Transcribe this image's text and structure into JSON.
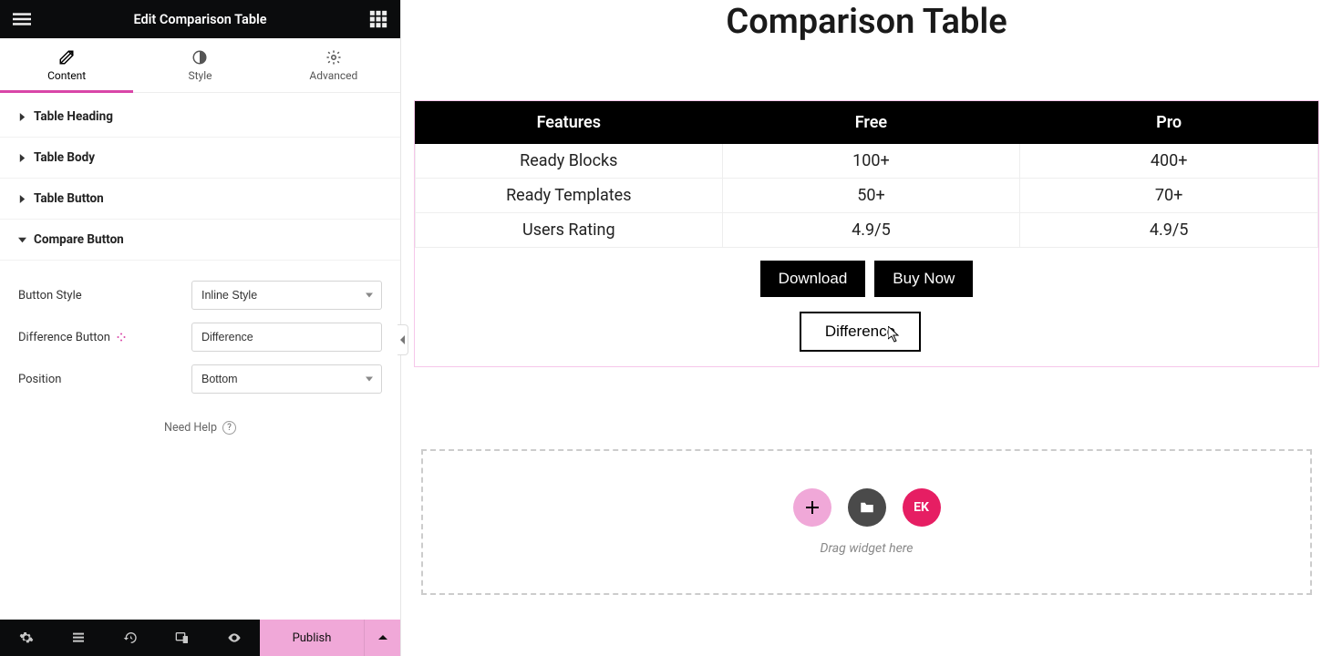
{
  "panel": {
    "title": "Edit Comparison Table",
    "tabs": {
      "content": "Content",
      "style": "Style",
      "advanced": "Advanced"
    },
    "sections": {
      "heading": "Table Heading",
      "body": "Table Body",
      "button": "Table Button",
      "compare": "Compare Button"
    },
    "compare": {
      "button_style_label": "Button Style",
      "button_style_value": "Inline Style",
      "diff_label": "Difference Button",
      "diff_value": "Difference",
      "position_label": "Position",
      "position_value": "Bottom"
    },
    "help": "Need Help",
    "publish": "Publish"
  },
  "preview": {
    "title": "Comparison Table",
    "columns": [
      "Features",
      "Free",
      "Pro"
    ],
    "rows": [
      {
        "feature": "Ready Blocks",
        "free": "100+",
        "pro": "400+"
      },
      {
        "feature": "Ready Templates",
        "free": "50+",
        "pro": "70+"
      },
      {
        "feature": "Users Rating",
        "free": "4.9/5",
        "pro": "4.9/5"
      }
    ],
    "buttons": {
      "download": "Download",
      "buy": "Buy Now",
      "diff": "Difference"
    },
    "placeholder_logo": "EK",
    "dropzone_text": "Drag widget here"
  }
}
